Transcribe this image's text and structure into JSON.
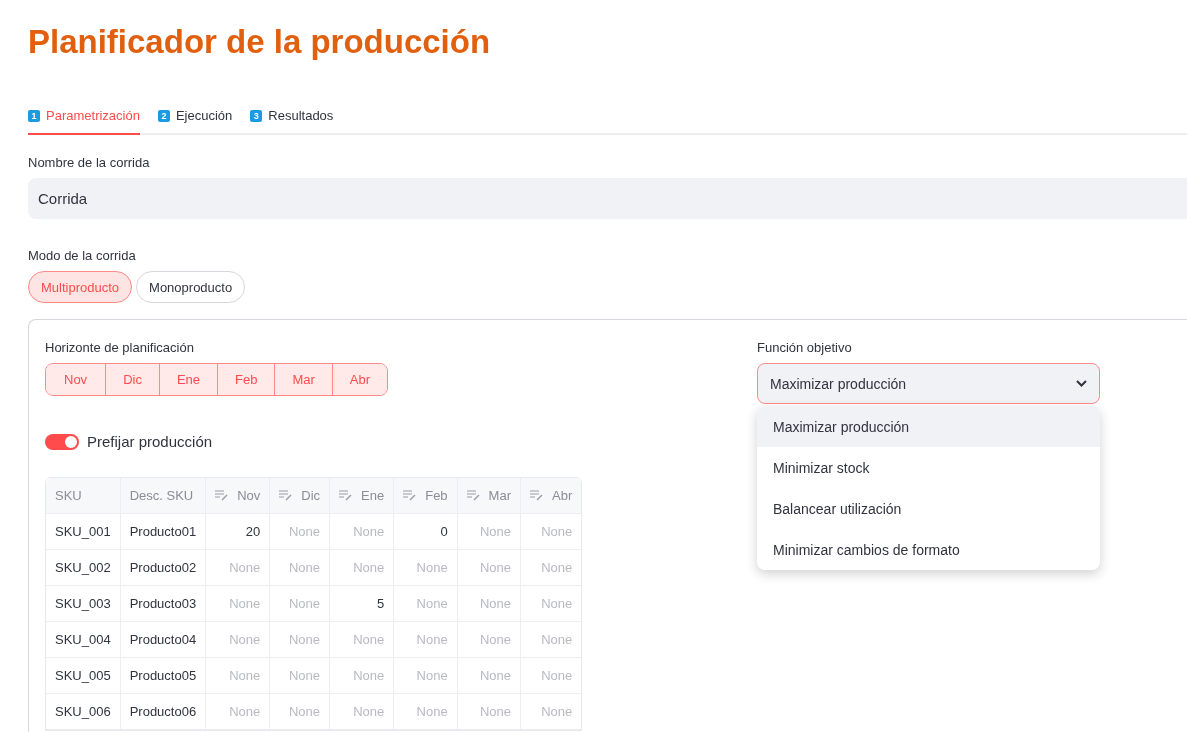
{
  "title": "Planificador de la producción",
  "tabs": [
    {
      "number": "1",
      "label": "Parametrización",
      "selected": true
    },
    {
      "number": "2",
      "label": "Ejecución",
      "selected": false
    },
    {
      "number": "3",
      "label": "Resultados",
      "selected": false
    }
  ],
  "run_name": {
    "label": "Nombre de la corrida",
    "value": "Corrida"
  },
  "run_mode": {
    "label": "Modo de la corrida",
    "options": [
      {
        "label": "Multiproducto",
        "selected": true
      },
      {
        "label": "Monoproducto",
        "selected": false
      }
    ]
  },
  "horizon": {
    "label": "Horizonte de planificación",
    "months": [
      {
        "label": "Nov",
        "selected": true
      },
      {
        "label": "Dic",
        "selected": true
      },
      {
        "label": "Ene",
        "selected": true
      },
      {
        "label": "Feb",
        "selected": true
      },
      {
        "label": "Mar",
        "selected": true
      },
      {
        "label": "Abr",
        "selected": true
      }
    ]
  },
  "prefix_toggle": {
    "label": "Prefijar producción",
    "on": true
  },
  "table": {
    "columns": [
      {
        "label": "SKU",
        "editable": false
      },
      {
        "label": "Desc. SKU",
        "editable": false
      },
      {
        "label": "Nov",
        "editable": true
      },
      {
        "label": "Dic",
        "editable": true
      },
      {
        "label": "Ene",
        "editable": true
      },
      {
        "label": "Feb",
        "editable": true
      },
      {
        "label": "Mar",
        "editable": true
      },
      {
        "label": "Abr",
        "editable": true
      }
    ],
    "rows": [
      {
        "sku": "SKU_001",
        "desc": "Producto01",
        "values": [
          {
            "text": "20",
            "empty": false
          },
          {
            "text": "None",
            "empty": true
          },
          {
            "text": "None",
            "empty": true
          },
          {
            "text": "0",
            "empty": false
          },
          {
            "text": "None",
            "empty": true
          },
          {
            "text": "None",
            "empty": true
          }
        ]
      },
      {
        "sku": "SKU_002",
        "desc": "Producto02",
        "values": [
          {
            "text": "None",
            "empty": true
          },
          {
            "text": "None",
            "empty": true
          },
          {
            "text": "None",
            "empty": true
          },
          {
            "text": "None",
            "empty": true
          },
          {
            "text": "None",
            "empty": true
          },
          {
            "text": "None",
            "empty": true
          }
        ]
      },
      {
        "sku": "SKU_003",
        "desc": "Producto03",
        "values": [
          {
            "text": "None",
            "empty": true
          },
          {
            "text": "None",
            "empty": true
          },
          {
            "text": "5",
            "empty": false
          },
          {
            "text": "None",
            "empty": true
          },
          {
            "text": "None",
            "empty": true
          },
          {
            "text": "None",
            "empty": true
          }
        ]
      },
      {
        "sku": "SKU_004",
        "desc": "Producto04",
        "values": [
          {
            "text": "None",
            "empty": true
          },
          {
            "text": "None",
            "empty": true
          },
          {
            "text": "None",
            "empty": true
          },
          {
            "text": "None",
            "empty": true
          },
          {
            "text": "None",
            "empty": true
          },
          {
            "text": "None",
            "empty": true
          }
        ]
      },
      {
        "sku": "SKU_005",
        "desc": "Producto05",
        "values": [
          {
            "text": "None",
            "empty": true
          },
          {
            "text": "None",
            "empty": true
          },
          {
            "text": "None",
            "empty": true
          },
          {
            "text": "None",
            "empty": true
          },
          {
            "text": "None",
            "empty": true
          },
          {
            "text": "None",
            "empty": true
          }
        ]
      },
      {
        "sku": "SKU_006",
        "desc": "Producto06",
        "values": [
          {
            "text": "None",
            "empty": true
          },
          {
            "text": "None",
            "empty": true
          },
          {
            "text": "None",
            "empty": true
          },
          {
            "text": "None",
            "empty": true
          },
          {
            "text": "None",
            "empty": true
          },
          {
            "text": "None",
            "empty": true
          }
        ]
      }
    ]
  },
  "objective": {
    "label": "Función objetivo",
    "value": "Maximizar producción",
    "open": true,
    "options": [
      {
        "label": "Maximizar producción",
        "selected": true
      },
      {
        "label": "Minimizar stock",
        "selected": false
      },
      {
        "label": "Balancear utilización",
        "selected": false
      },
      {
        "label": "Minimizar cambios de formato",
        "selected": false
      }
    ]
  }
}
